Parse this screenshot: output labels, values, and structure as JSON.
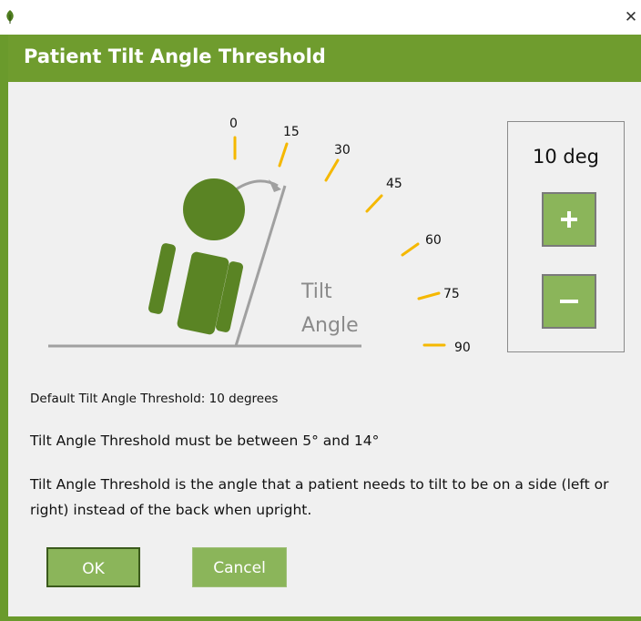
{
  "window": {
    "close_glyph": "✕",
    "app_icon": "leaf-icon"
  },
  "header": {
    "title": "Patient Tilt Angle Threshold"
  },
  "diagram": {
    "ticks": [
      "0",
      "15",
      "30",
      "45",
      "60",
      "75",
      "90"
    ],
    "tilt_label_line1": "Tilt",
    "tilt_label_line2": "Angle",
    "colors": {
      "tick": "#f5b800",
      "figure": "#5a8424",
      "line": "#a0a0a0"
    }
  },
  "degree_panel": {
    "value": "10 deg"
  },
  "info": {
    "default_text": "Default Tilt Angle Threshold: 10 degrees",
    "range_text": "Tilt Angle Threshold must be between 5° and 14°",
    "description": "Tilt Angle Threshold is the angle that a patient needs to tilt to be on a side (left or right) instead of the back when upright."
  },
  "buttons": {
    "ok": "OK",
    "cancel": "Cancel"
  },
  "colors": {
    "accent": "#6f9c2e",
    "button": "#8bb55a",
    "background": "#f0f0f0"
  }
}
